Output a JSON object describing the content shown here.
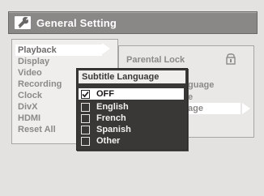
{
  "window": {
    "title": "General Setting"
  },
  "left_menu": {
    "items": [
      {
        "label": "Playback"
      },
      {
        "label": "Display"
      },
      {
        "label": "Video"
      },
      {
        "label": "Recording"
      },
      {
        "label": "Clock"
      },
      {
        "label": "DivX"
      },
      {
        "label": "HDMI"
      },
      {
        "label": "Reset All"
      }
    ]
  },
  "right_menu": {
    "items": [
      {
        "label": "Parental Lock"
      },
      {
        "label": "guage"
      },
      {
        "label": "e"
      },
      {
        "label": "age"
      }
    ]
  },
  "popup": {
    "title": "Subtitle Language",
    "options": [
      {
        "label": "OFF",
        "checked": true
      },
      {
        "label": "English",
        "checked": false
      },
      {
        "label": "French",
        "checked": false
      },
      {
        "label": "Spanish",
        "checked": false
      },
      {
        "label": "Other",
        "checked": false
      }
    ]
  },
  "colors": {
    "titlebar": "#8a8886",
    "popup_bg": "#3a3836",
    "highlight": "#ffffff"
  }
}
